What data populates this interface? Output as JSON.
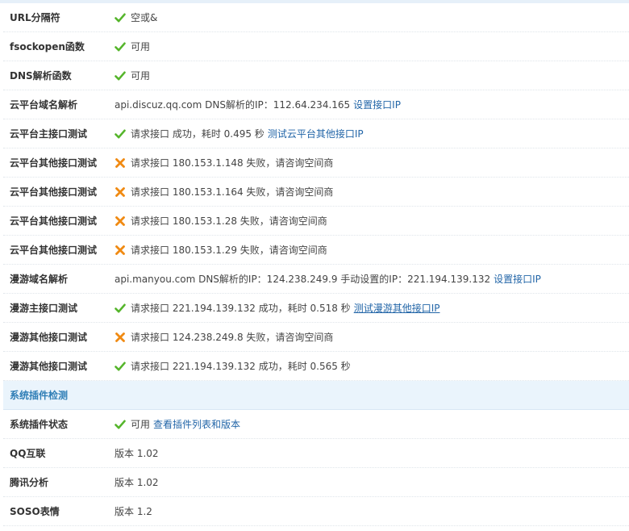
{
  "colors": {
    "ok": "#55b52b",
    "fail": "#f08a12",
    "link": "#2366a8",
    "section": "#2f7eb6",
    "section_bg": "#eaf4fc"
  },
  "rows": [
    {
      "label": "URL分隔符",
      "icon": "check-icon",
      "text": "空或&"
    },
    {
      "label": "fsockopen函数",
      "icon": "check-icon",
      "text": "可用"
    },
    {
      "label": "DNS解析函数",
      "icon": "check-icon",
      "text": "可用"
    },
    {
      "label": "云平台域名解析",
      "text": "api.discuz.qq.com DNS解析的IP：112.64.234.165",
      "link": "设置接口IP"
    },
    {
      "label": "云平台主接口测试",
      "icon": "check-icon",
      "text": "请求接口 成功，耗时 0.495 秒",
      "link": "测试云平台其他接口IP"
    },
    {
      "label": "云平台其他接口测试",
      "icon": "cross-icon",
      "text": "请求接口 180.153.1.148 失败，请咨询空间商"
    },
    {
      "label": "云平台其他接口测试",
      "icon": "cross-icon",
      "text": "请求接口 180.153.1.164 失败，请咨询空间商"
    },
    {
      "label": "云平台其他接口测试",
      "icon": "cross-icon",
      "text": "请求接口 180.153.1.28 失败，请咨询空间商"
    },
    {
      "label": "云平台其他接口测试",
      "icon": "cross-icon",
      "text": "请求接口 180.153.1.29 失败，请咨询空间商"
    },
    {
      "label": "漫游域名解析",
      "text": "api.manyou.com DNS解析的IP：124.238.249.9 手动设置的IP：221.194.139.132",
      "link": "设置接口IP"
    },
    {
      "label": "漫游主接口测试",
      "icon": "check-icon",
      "text": "请求接口 221.194.139.132 成功，耗时 0.518 秒",
      "link": "测试漫游其他接口IP"
    },
    {
      "label": "漫游其他接口测试",
      "icon": "cross-icon",
      "text": "请求接口 124.238.249.8 失败，请咨询空间商"
    },
    {
      "label": "漫游其他接口测试",
      "icon": "check-icon",
      "text": "请求接口 221.194.139.132 成功，耗时 0.565 秒"
    }
  ],
  "section_title": "系统插件检测",
  "plugin_rows": [
    {
      "label": "系统插件状态",
      "icon": "check-icon",
      "text": "可用",
      "link": "查看插件列表和版本"
    },
    {
      "label": "QQ互联",
      "text": "版本 1.02"
    },
    {
      "label": "腾讯分析",
      "text": "版本 1.02"
    },
    {
      "label": "SOSO表情",
      "text": "版本 1.2"
    }
  ]
}
